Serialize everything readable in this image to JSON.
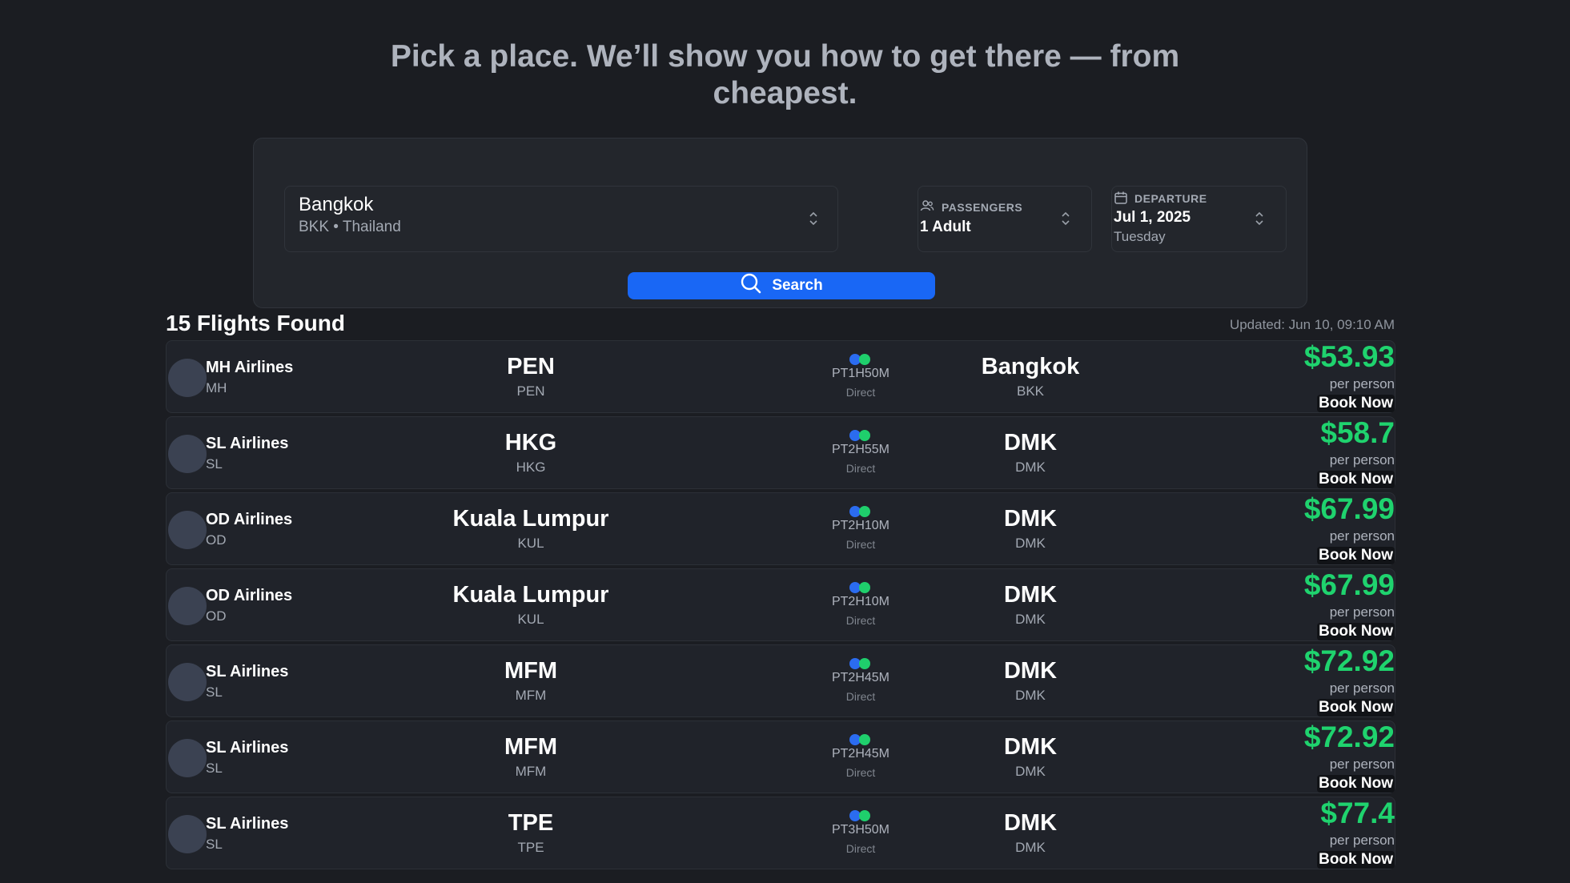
{
  "hero": {
    "line1": "Pick a place. We’ll show you how to get there — from",
    "line2": "cheapest."
  },
  "search": {
    "destination": {
      "city": "Bangkok",
      "detail": "BKK • Thailand"
    },
    "passengers": {
      "label": "PASSENGERS",
      "value": "1 Adult"
    },
    "departure": {
      "label": "DEPARTURE",
      "value": "Jul 1, 2025",
      "day": "Tuesday"
    },
    "button_label": "Search"
  },
  "results": {
    "title": "15 Flights Found",
    "updated": "Updated: Jun 10, 09:10 AM",
    "per_person_label": "per person",
    "book_label": "Book Now",
    "flights": [
      {
        "airline": "MH Airlines",
        "code": "MH",
        "origin_name": "PEN",
        "origin_code": "PEN",
        "duration": "PT1H50M",
        "stops": "Direct",
        "dest_name": "Bangkok",
        "dest_code": "BKK",
        "price": "$53.93"
      },
      {
        "airline": "SL Airlines",
        "code": "SL",
        "origin_name": "HKG",
        "origin_code": "HKG",
        "duration": "PT2H55M",
        "stops": "Direct",
        "dest_name": "DMK",
        "dest_code": "DMK",
        "price": "$58.7"
      },
      {
        "airline": "OD Airlines",
        "code": "OD",
        "origin_name": "Kuala Lumpur",
        "origin_code": "KUL",
        "duration": "PT2H10M",
        "stops": "Direct",
        "dest_name": "DMK",
        "dest_code": "DMK",
        "price": "$67.99"
      },
      {
        "airline": "OD Airlines",
        "code": "OD",
        "origin_name": "Kuala Lumpur",
        "origin_code": "KUL",
        "duration": "PT2H10M",
        "stops": "Direct",
        "dest_name": "DMK",
        "dest_code": "DMK",
        "price": "$67.99"
      },
      {
        "airline": "SL Airlines",
        "code": "SL",
        "origin_name": "MFM",
        "origin_code": "MFM",
        "duration": "PT2H45M",
        "stops": "Direct",
        "dest_name": "DMK",
        "dest_code": "DMK",
        "price": "$72.92"
      },
      {
        "airline": "SL Airlines",
        "code": "SL",
        "origin_name": "MFM",
        "origin_code": "MFM",
        "duration": "PT2H45M",
        "stops": "Direct",
        "dest_name": "DMK",
        "dest_code": "DMK",
        "price": "$72.92"
      },
      {
        "airline": "SL Airlines",
        "code": "SL",
        "origin_name": "TPE",
        "origin_code": "TPE",
        "duration": "PT3H50M",
        "stops": "Direct",
        "dest_name": "DMK",
        "dest_code": "DMK",
        "price": "$77.4"
      }
    ]
  },
  "colors": {
    "background": "#1b1d22",
    "accent": "#1967f5",
    "price": "#1fd36e"
  },
  "icons": {
    "passengers": "users-icon",
    "departure": "calendar-icon",
    "search": "search-icon",
    "selector": "chevron-up-down-icon"
  }
}
